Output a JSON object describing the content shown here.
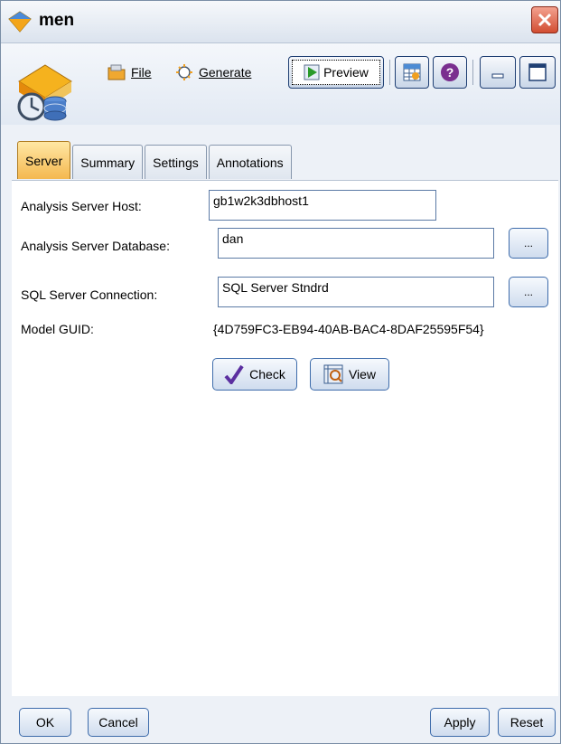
{
  "window": {
    "title": "men"
  },
  "toolbar": {
    "file_label": "File",
    "generate_label": "Generate",
    "preview_label": "Preview"
  },
  "tabs": [
    {
      "label": "Server",
      "active": true
    },
    {
      "label": "Summary",
      "active": false
    },
    {
      "label": "Settings",
      "active": false
    },
    {
      "label": "Annotations",
      "active": false
    }
  ],
  "server": {
    "host_label": "Analysis Server Host:",
    "host_value": "gb1w2k3dbhost1",
    "database_label": "Analysis Server Database:",
    "database_value": "dan",
    "sql_label": "SQL Server Connection:",
    "sql_value": "SQL Server Stndrd",
    "browse_label": "...",
    "guid_label": "Model GUID:",
    "guid_value": "{4D759FC3-EB94-40AB-BAC4-8DAF25595F54}",
    "check_label": "Check",
    "view_label": "View"
  },
  "footer": {
    "ok_label": "OK",
    "cancel_label": "Cancel",
    "apply_label": "Apply",
    "reset_label": "Reset"
  },
  "icons": {
    "title": "diamond-icon",
    "close": "close-icon",
    "node": "database-model-icon",
    "file": "folder-icon",
    "generate": "generate-icon",
    "preview": "play-icon",
    "table": "table-icon",
    "help": "help-icon",
    "minimize": "minimize-icon",
    "maximize": "maximize-icon",
    "check": "checkmark-icon",
    "view": "view-icon"
  },
  "colors": {
    "active_tab": "#f4b850",
    "close_button": "#d24d32",
    "border_blue": "#3e6cab"
  }
}
